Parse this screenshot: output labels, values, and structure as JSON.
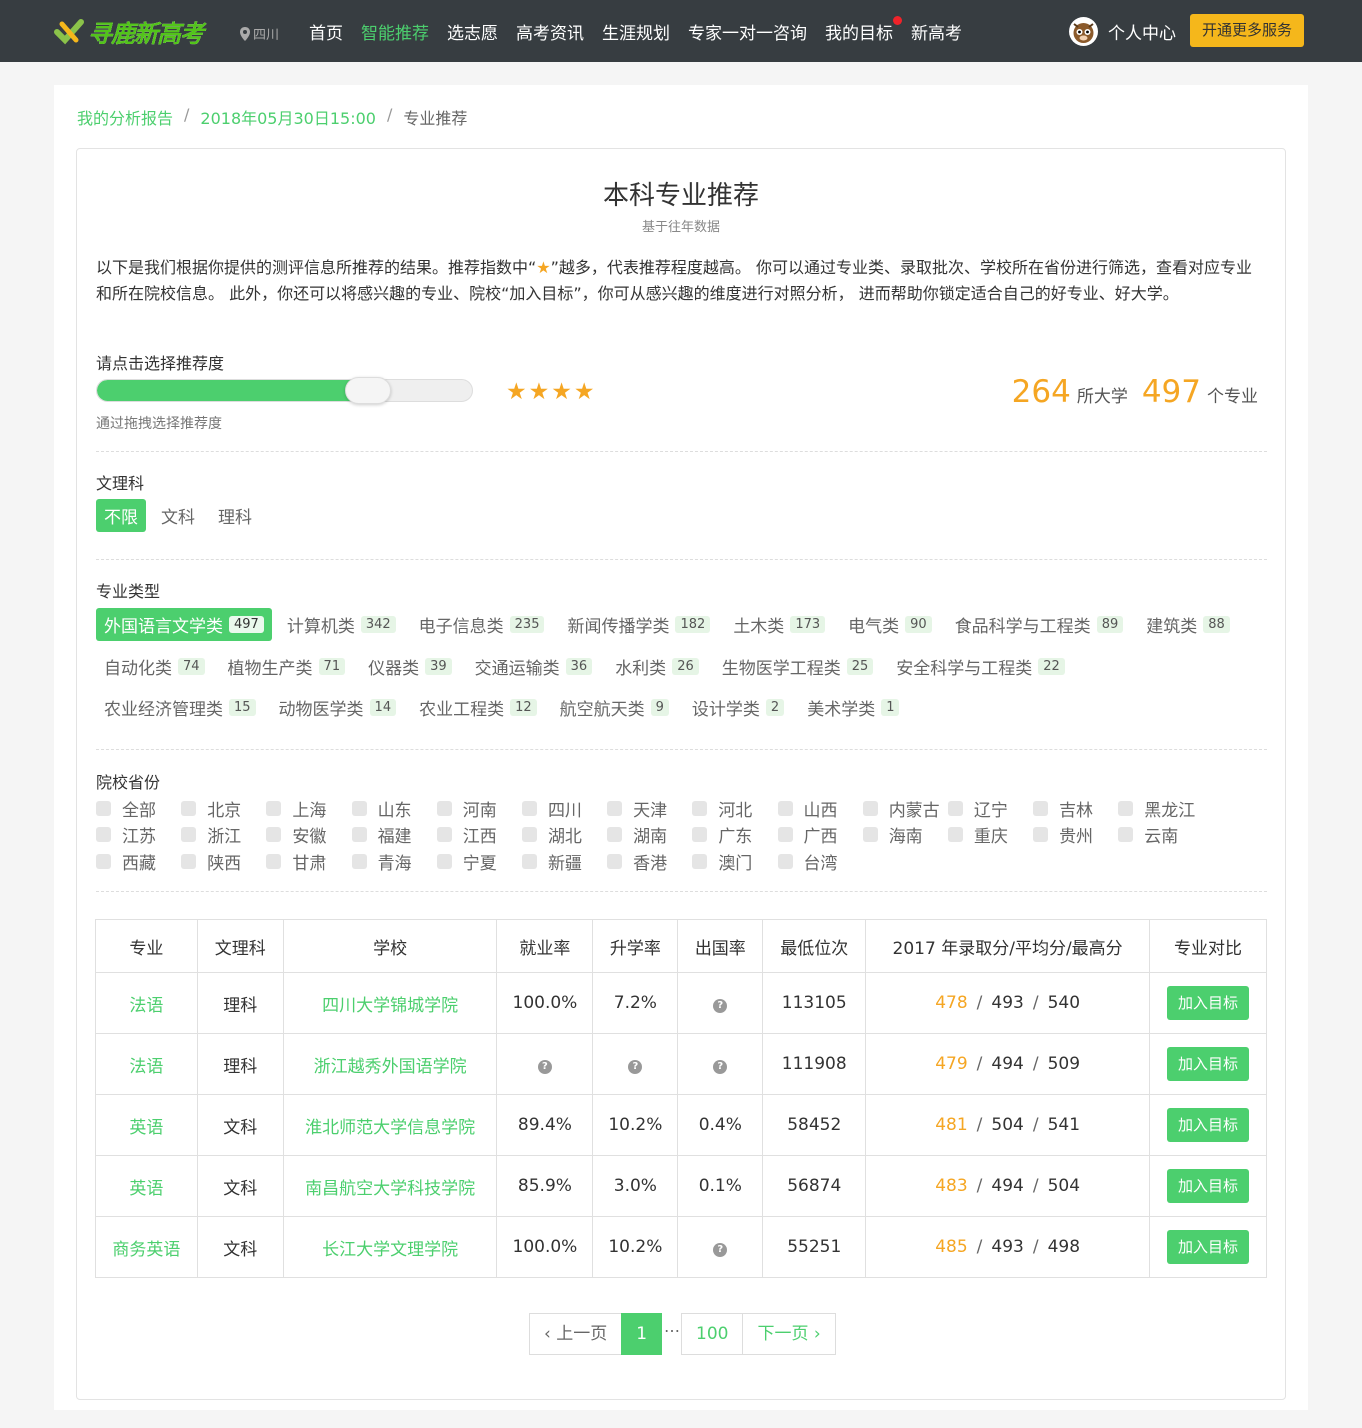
{
  "nav": {
    "logo": "寻鹿新高考",
    "location": "四川",
    "menu": [
      "首页",
      "智能推荐",
      "选志愿",
      "高考资讯",
      "生涯规划",
      "专家一对一咨询",
      "我的目标",
      "新高考"
    ],
    "active_index": 1,
    "user_label": "个人中心",
    "vip_button": "开通更多服务",
    "accent": "#4ccf6e"
  },
  "breadcrumb": {
    "items": [
      "我的分析报告",
      "2018年05月30日15:00"
    ],
    "current": "专业推荐"
  },
  "header": {
    "title": "本科专业推荐",
    "subtitle": "基于往年数据"
  },
  "intro": {
    "before": "以下是我们根据你提供的测评信息所推荐的结果。推荐指数中“",
    "after": "”越多，代表推荐程度越高。 你可以通过专业类、录取批次、学校所在省份进行筛选，查看对应专业和所在院校信息。 此外，你还可以将感兴趣的专业、院校“加入目标”，你可从感兴趣的维度进行对照分析， 进而帮助你锁定适合自己的好专业、好大学。"
  },
  "recommend": {
    "label": "请点击选择推荐度",
    "hint": "通过拖拽选择推荐度",
    "level_fraction": 0.73,
    "stars": 4,
    "uni_count": "264",
    "uni_unit": "所大学",
    "major_count": "497",
    "major_unit": "个专业"
  },
  "subject": {
    "label": "文理科",
    "options": [
      "不限",
      "文科",
      "理科"
    ],
    "selected": 0
  },
  "major_type": {
    "label": "专业类型",
    "rows": [
      [
        {
          "name": "外国语言文学类",
          "count": "497"
        },
        {
          "name": "计算机类",
          "count": "342"
        },
        {
          "name": "电子信息类",
          "count": "235"
        },
        {
          "name": "新闻传播学类",
          "count": "182"
        },
        {
          "name": "土木类",
          "count": "173"
        },
        {
          "name": "电气类",
          "count": "90"
        },
        {
          "name": "食品科学与工程类",
          "count": "89"
        },
        {
          "name": "建筑类",
          "count": "88"
        }
      ],
      [
        {
          "name": "自动化类",
          "count": "74"
        },
        {
          "name": "植物生产类",
          "count": "71"
        },
        {
          "name": "仪器类",
          "count": "39"
        },
        {
          "name": "交通运输类",
          "count": "36"
        },
        {
          "name": "水利类",
          "count": "26"
        },
        {
          "name": "生物医学工程类",
          "count": "25"
        },
        {
          "name": "安全科学与工程类",
          "count": "22"
        }
      ],
      [
        {
          "name": "农业经济管理类",
          "count": "15"
        },
        {
          "name": "动物医学类",
          "count": "14"
        },
        {
          "name": "农业工程类",
          "count": "12"
        },
        {
          "name": "航空航天类",
          "count": "9"
        },
        {
          "name": "设计学类",
          "count": "2"
        },
        {
          "name": "美术学类",
          "count": "1"
        }
      ]
    ],
    "selected": "外国语言文学类"
  },
  "province": {
    "label": "院校省份",
    "rows": [
      [
        "全部",
        "北京",
        "上海",
        "山东",
        "河南",
        "四川",
        "天津",
        "河北",
        "山西",
        "内蒙古",
        "辽宁",
        "吉林",
        "黑龙江"
      ],
      [
        "江苏",
        "浙江",
        "安徽",
        "福建",
        "江西",
        "湖北",
        "湖南",
        "广东",
        "广西",
        "海南",
        "重庆",
        "贵州",
        "云南"
      ],
      [
        "西藏",
        "陕西",
        "甘肃",
        "青海",
        "宁夏",
        "新疆",
        "香港",
        "澳门",
        "台湾"
      ]
    ]
  },
  "table": {
    "headers": [
      "专业",
      "文理科",
      "学校",
      "就业率",
      "升学率",
      "出国率",
      "最低位次",
      "2017 年录取分/平均分/最高分",
      "专业对比"
    ],
    "add_label": "加入目标",
    "rows": [
      {
        "major": "法语",
        "subject": "理科",
        "school": "四川大学锦城学院",
        "employ": "100.0%",
        "further": "7.2%",
        "abroad": "?",
        "rank": "113105",
        "min": "478",
        "avg": "493",
        "max": "540"
      },
      {
        "major": "法语",
        "subject": "理科",
        "school": "浙江越秀外国语学院",
        "employ": "?",
        "further": "?",
        "abroad": "?",
        "rank": "111908",
        "min": "479",
        "avg": "494",
        "max": "509"
      },
      {
        "major": "英语",
        "subject": "文科",
        "school": "淮北师范大学信息学院",
        "employ": "89.4%",
        "further": "10.2%",
        "abroad": "0.4%",
        "rank": "58452",
        "min": "481",
        "avg": "504",
        "max": "541"
      },
      {
        "major": "英语",
        "subject": "文科",
        "school": "南昌航空大学科技学院",
        "employ": "85.9%",
        "further": "3.0%",
        "abroad": "0.1%",
        "rank": "56874",
        "min": "483",
        "avg": "494",
        "max": "504"
      },
      {
        "major": "商务英语",
        "subject": "文科",
        "school": "长江大学文理学院",
        "employ": "100.0%",
        "further": "10.2%",
        "abroad": "?",
        "rank": "55251",
        "min": "485",
        "avg": "493",
        "max": "498"
      }
    ]
  },
  "pager": {
    "prev": "‹ 上一页",
    "current": "1",
    "ellipsis": "…",
    "last": "100",
    "next": "下一页 ›"
  }
}
